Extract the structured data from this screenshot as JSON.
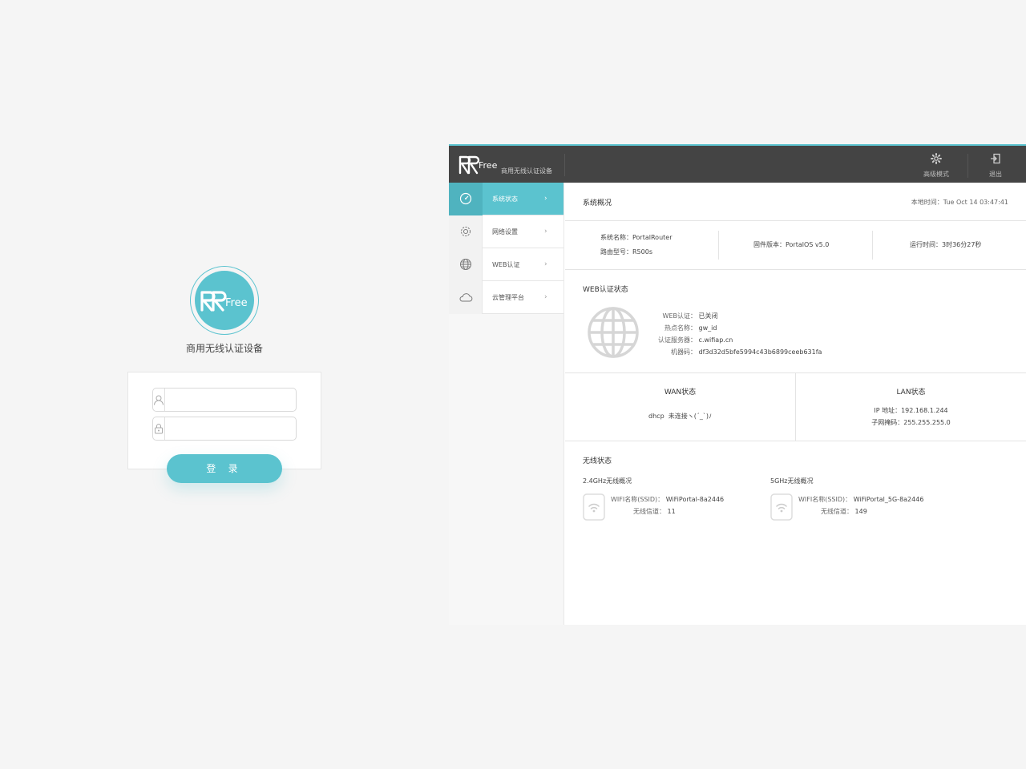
{
  "login": {
    "logo_text": "RRFree",
    "subtitle": "商用无线认证设备",
    "username_placeholder": "",
    "password_placeholder": "",
    "submit_label": "登 录",
    "icons": {
      "username": "user-icon",
      "password": "lock-icon"
    }
  },
  "header": {
    "logo_text": "RRFree",
    "subtitle": "商用无线认证设备",
    "advanced_label": "高级模式",
    "logout_label": "退出",
    "icons": {
      "advanced": "gear-icon",
      "logout": "logout-icon"
    }
  },
  "sidebar": {
    "items": [
      {
        "label": "系统状态",
        "icon": "dashboard-icon",
        "active": true
      },
      {
        "label": "网络设置",
        "icon": "gear-icon",
        "active": false
      },
      {
        "label": "WEB认证",
        "icon": "globe-icon",
        "active": false
      },
      {
        "label": "云管理平台",
        "icon": "cloud-icon",
        "active": false
      }
    ]
  },
  "overview": {
    "title": "系统概况",
    "local_time_label": "本地时间：",
    "local_time": "Tue Oct 14 03:47:41",
    "system_name_label": "系统名称：",
    "system_name": "PortalRouter",
    "router_model_label": "路由型号：",
    "router_model": "R500s",
    "firmware_label": "固件版本：",
    "firmware": "PortalOS v5.0",
    "uptime_label": "运行时间：",
    "uptime": "3时36分27秒"
  },
  "web_auth": {
    "title": "WEB认证状态",
    "rows": [
      {
        "label": "WEB认证：",
        "value": "已关闭"
      },
      {
        "label": "热点名称：",
        "value": "gw_id"
      },
      {
        "label": "认证服务器：",
        "value": "c.wifiap.cn"
      },
      {
        "label": "机器码：",
        "value": "df3d32d5bfe5994c43b6899ceeb631fa"
      }
    ]
  },
  "wan": {
    "title": "WAN状态",
    "protocol": "dhcp",
    "status": "未连接ヽ(ˊ_ˋ)ﾉ"
  },
  "lan": {
    "title": "LAN状态",
    "ip_label": "IP 地址：",
    "ip": "192.168.1.244",
    "mask_label": "子网掩码：",
    "mask": "255.255.255.0"
  },
  "wireless": {
    "title": "无线状态",
    "bands": [
      {
        "title": "2.4GHz无线概况",
        "ssid_label": "WIFI名称(SSID)：",
        "ssid": "WiFiPortal-8a2446",
        "channel_label": "无线信道：",
        "channel": "11"
      },
      {
        "title": "5GHz无线概况",
        "ssid_label": "WIFI名称(SSID)：",
        "ssid": "WiFiPortal_5G-8a2446",
        "channel_label": "无线信道：",
        "channel": "149"
      }
    ]
  },
  "colors": {
    "accent": "#5bc3cf",
    "header_bg": "#444444",
    "page_bg": "#f5f5f5"
  }
}
